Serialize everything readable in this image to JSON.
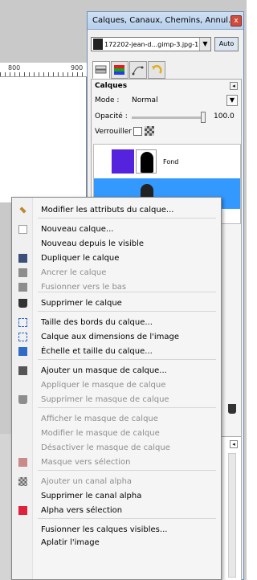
{
  "dock": {
    "title": "Calques, Canaux, Chemins, Annul...",
    "close_label": "x",
    "image_combo_text": "172202-jean-d...gimp-3.jpg-1",
    "auto_label": "Auto"
  },
  "ruler": {
    "label_a": "800",
    "label_b": "900"
  },
  "layers_panel": {
    "title": "Calques",
    "mode_label": "Mode :",
    "mode_value": "Normal",
    "opacity_label": "Opacité :",
    "opacity_value": "100.0",
    "lock_label": "Verrouiller :",
    "layers": [
      {
        "name": "Fond",
        "thumb_color": "#5522dd"
      },
      {
        "name": "",
        "thumb_color": "#3399ff"
      }
    ]
  },
  "context_menu": {
    "items": [
      {
        "label": "Modifier les attributs du calque...",
        "enabled": true,
        "icon": "pencil-icon",
        "color": "#c0872f"
      },
      {
        "label": "Nouveau calque...",
        "enabled": true,
        "icon": "new-page-icon",
        "color": "#9a9a9a"
      },
      {
        "label": "Nouveau depuis le visible",
        "enabled": true,
        "icon": "",
        "color": ""
      },
      {
        "label": "Dupliquer le calque",
        "enabled": true,
        "icon": "duplicate-icon",
        "color": "#3b4f7a"
      },
      {
        "label": "Ancrer le calque",
        "enabled": false,
        "icon": "anchor-icon",
        "color": "#8d8d8d"
      },
      {
        "label": "Fusionner vers le bas",
        "enabled": false,
        "icon": "merge-down-icon",
        "color": "#8d8d8d"
      },
      {
        "label": "Supprimer le calque",
        "enabled": true,
        "icon": "trash-icon",
        "color": "#333333"
      },
      {
        "label": "Taille des bords du calque...",
        "enabled": true,
        "icon": "resize-border-icon",
        "color": "#2f6bc7"
      },
      {
        "label": "Calque aux dimensions de l'image",
        "enabled": true,
        "icon": "fit-image-icon",
        "color": "#2f6bc7"
      },
      {
        "label": "Échelle et taille du calque...",
        "enabled": true,
        "icon": "scale-icon",
        "color": "#2f6bc7"
      },
      {
        "label": "Ajouter un masque de calque...",
        "enabled": true,
        "icon": "add-mask-icon",
        "color": "#555555"
      },
      {
        "label": "Appliquer le masque de calque",
        "enabled": false,
        "icon": "",
        "color": ""
      },
      {
        "label": "Supprimer le masque de calque",
        "enabled": false,
        "icon": "trash-icon",
        "color": "#8d8d8d"
      },
      {
        "label": "Afficher le masque de calque",
        "enabled": false,
        "icon": "",
        "color": ""
      },
      {
        "label": "Modifier le masque de calque",
        "enabled": false,
        "icon": "",
        "color": ""
      },
      {
        "label": "Désactiver le masque de calque",
        "enabled": false,
        "icon": "",
        "color": ""
      },
      {
        "label": "Masque vers sélection",
        "enabled": false,
        "icon": "mask-to-selection-icon",
        "color": "#c88a8a"
      },
      {
        "label": "Ajouter un canal alpha",
        "enabled": false,
        "icon": "alpha-checker-icon",
        "color": "#8d8d8d"
      },
      {
        "label": "Supprimer le canal alpha",
        "enabled": true,
        "icon": "",
        "color": ""
      },
      {
        "label": "Alpha vers sélection",
        "enabled": true,
        "icon": "alpha-to-selection-icon",
        "color": "#e0213b"
      },
      {
        "label": "Fusionner les calques visibles...",
        "enabled": true,
        "icon": "",
        "color": ""
      },
      {
        "label": "Aplatir l'image",
        "enabled": true,
        "icon": "",
        "color": ""
      }
    ]
  }
}
